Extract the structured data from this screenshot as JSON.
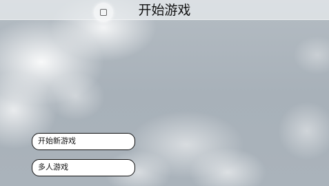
{
  "header": {
    "title": "开始游戏"
  },
  "icons": {
    "menu": "square-menu-icon"
  },
  "menu": {
    "options": [
      {
        "label": "开始新游戏"
      },
      {
        "label": "多人游戏"
      }
    ]
  },
  "colors": {
    "title_bar": "#e6e9ec",
    "sky": "#a9b2ba",
    "button_bg": "#ffffff",
    "button_border": "#111111"
  }
}
